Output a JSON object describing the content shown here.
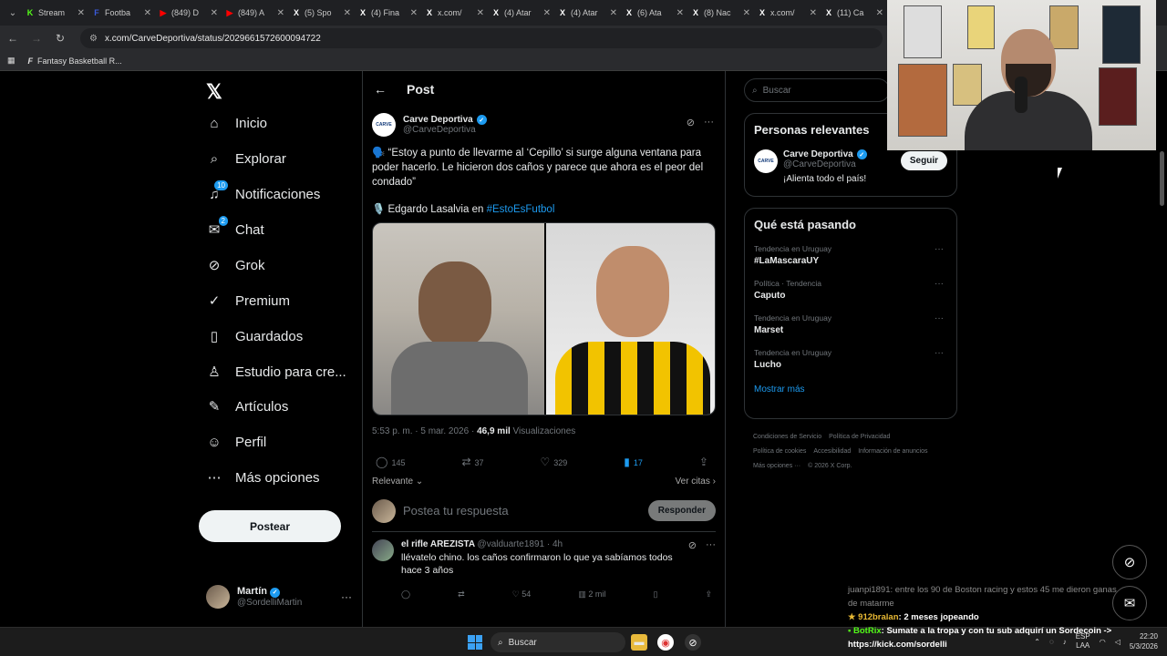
{
  "browser": {
    "tabs": [
      {
        "title": "Stream",
        "icon": "kick-icon",
        "color": "#53fc18",
        "glyph": "K"
      },
      {
        "title": "Footba",
        "icon": "fantasy-icon",
        "color": "#3b5bdb",
        "glyph": "F"
      },
      {
        "title": "(849) D",
        "icon": "youtube-icon",
        "color": "#ff0000",
        "glyph": "▶"
      },
      {
        "title": "(849) A",
        "icon": "youtube-icon",
        "color": "#ff0000",
        "glyph": "▶"
      },
      {
        "title": "(5) Spo",
        "icon": "x-icon",
        "color": "#ffffff",
        "glyph": "X"
      },
      {
        "title": "(4) Fina",
        "icon": "x-icon",
        "color": "#ffffff",
        "glyph": "X"
      },
      {
        "title": "x.com/",
        "icon": "x-icon",
        "color": "#ffffff",
        "glyph": "X"
      },
      {
        "title": "(4) Atar",
        "icon": "x-icon",
        "color": "#ffffff",
        "glyph": "X"
      },
      {
        "title": "(4) Atar",
        "icon": "x-icon",
        "color": "#ffffff",
        "glyph": "X"
      },
      {
        "title": "(6) Ata",
        "icon": "x-icon",
        "color": "#ffffff",
        "glyph": "X"
      },
      {
        "title": "(8) Nac",
        "icon": "x-icon",
        "color": "#ffffff",
        "glyph": "X"
      },
      {
        "title": "x.com/",
        "icon": "x-icon",
        "color": "#ffffff",
        "glyph": "X"
      },
      {
        "title": "(11) Ca",
        "icon": "x-icon",
        "color": "#ffffff",
        "glyph": "X"
      }
    ],
    "url": "x.com/CarveDeportiva/status/2029661572600094722",
    "bookmark": "Fantasy Basketball R..."
  },
  "sidebar": {
    "items": [
      {
        "label": "Inicio",
        "icon": "home-icon",
        "glyph": "⌂",
        "badge": ""
      },
      {
        "label": "Explorar",
        "icon": "search-icon",
        "glyph": "⌕",
        "badge": ""
      },
      {
        "label": "Notificaciones",
        "icon": "bell-icon",
        "glyph": "♫",
        "badge": "10"
      },
      {
        "label": "Chat",
        "icon": "mail-icon",
        "glyph": "✉",
        "badge": "2"
      },
      {
        "label": "Grok",
        "icon": "grok-icon",
        "glyph": "⊘",
        "badge": ""
      },
      {
        "label": "Premium",
        "icon": "premium-icon",
        "glyph": "✓",
        "badge": ""
      },
      {
        "label": "Guardados",
        "icon": "bookmark-icon",
        "glyph": "▯",
        "badge": ""
      },
      {
        "label": "Estudio para cre...",
        "icon": "creator-studio-icon",
        "glyph": "♙",
        "badge": ""
      },
      {
        "label": "Artículos",
        "icon": "articles-icon",
        "glyph": "✎",
        "badge": ""
      },
      {
        "label": "Perfil",
        "icon": "profile-icon",
        "glyph": "☺",
        "badge": ""
      },
      {
        "label": "Más opciones",
        "icon": "more-options-icon",
        "glyph": "⋯",
        "badge": ""
      }
    ],
    "post_button": "Postear",
    "account": {
      "name": "Martín",
      "handle": "@SordelliMartin"
    }
  },
  "main": {
    "header_title": "Post",
    "post": {
      "author": "Carve Deportiva",
      "handle": "@CarveDeportiva",
      "text": "🗣️ “Estoy a punto de llevarme al ‘Cepillo’ si surge alguna ventana para poder hacerlo. Le hicieron dos caños y parece que ahora es el peor del condado”",
      "credit_prefix": "🎙️ Edgardo Lasalvia en",
      "hashtag": "#EstoEsFutbol",
      "time": "5:53 p. m. · 5 mar. 2026 ·",
      "views_count": "46,9 mil",
      "views_label": "Visualizaciones",
      "replies": "145",
      "reposts": "37",
      "likes": "329",
      "bookmarks": "17",
      "sort_label": "Relevante",
      "quotes_label": "Ver citas"
    },
    "reply_placeholder": "Postea tu respuesta",
    "reply_button": "Responder",
    "reply": {
      "name": "el rifle AREZISTA",
      "handle": "@valduarte1891 · 4h",
      "text": "llévatelo chino. los caños confirmaron lo que ya sabíamos todos hace 3 años",
      "likes": "54",
      "views": "2 mil"
    }
  },
  "right": {
    "search_placeholder": "Buscar",
    "relevant_title": "Personas relevantes",
    "relevant_user": {
      "name": "Carve Deportiva",
      "handle": "@CarveDeportiva",
      "bio": "¡Alienta todo el país!",
      "follow": "Seguir"
    },
    "trending_title": "Qué está pasando",
    "trends": [
      {
        "context": "Tendencia en Uruguay",
        "name": "#LaMascaraUY"
      },
      {
        "context": "Política · Tendencia",
        "name": "Caputo"
      },
      {
        "context": "Tendencia en Uruguay",
        "name": "Marset"
      },
      {
        "context": "Tendencia en Uruguay",
        "name": "Lucho"
      }
    ],
    "show_more": "Mostrar más",
    "footer": [
      "Condiciones de Servicio",
      "Política de Privacidad",
      "Política de cookies",
      "Accesibilidad",
      "Información de anuncios",
      "Más opciones ···",
      "© 2026 X Corp."
    ]
  },
  "stream_chat": [
    {
      "user": "juanpi1891",
      "text": ": entre los 90 de Boston racing y estos 45 me dieron ganas de matarme"
    },
    {
      "user": "912bralan",
      "text": ": 2 meses jopeando"
    },
    {
      "user": "BotRix",
      "text": ": Sumate a la tropa y con tu sub adquirí un Sordecoin ->"
    },
    {
      "user": "",
      "text": "https://kick.com/sordelli"
    }
  ],
  "taskbar": {
    "search": "Buscar",
    "lang": "ESP",
    "lang2": "LAA",
    "time": "22:20",
    "date": "5/3/2026"
  }
}
